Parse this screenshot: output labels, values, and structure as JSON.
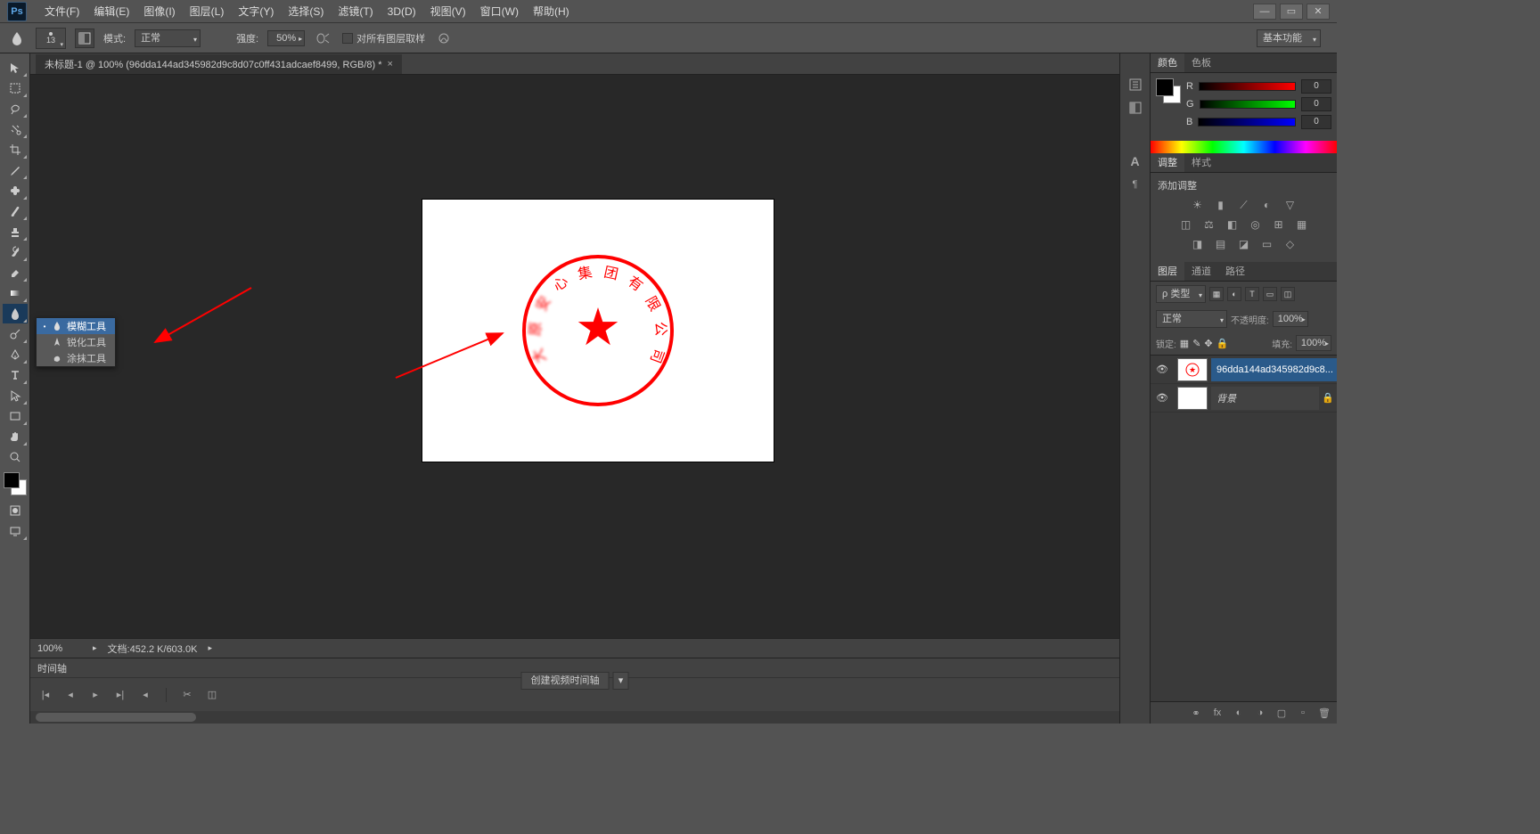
{
  "menu": {
    "items": [
      "文件(F)",
      "编辑(E)",
      "图像(I)",
      "图层(L)",
      "文字(Y)",
      "选择(S)",
      "滤镜(T)",
      "3D(D)",
      "视图(V)",
      "窗口(W)",
      "帮助(H)"
    ]
  },
  "optbar": {
    "brush_size": "13",
    "mode_lbl": "模式:",
    "mode_val": "正常",
    "strength_lbl": "强度:",
    "strength_val": "50%",
    "sample_all": "对所有图层取样",
    "basic": "基本功能"
  },
  "doc": {
    "tab": "未标题-1 @ 100% (96dda144ad345982d9c8d07c0ff431adcaef8499, RGB/8) *",
    "zoom": "100%",
    "info": "文档:452.2 K/603.0K"
  },
  "flyout": {
    "items": [
      "模糊工具",
      "锐化工具",
      "涂抹工具"
    ]
  },
  "timeline": {
    "title": "时间轴",
    "create": "创建视频时间轴"
  },
  "color": {
    "tab1": "颜色",
    "tab2": "色板",
    "r": "R",
    "g": "G",
    "b": "B",
    "rv": "0",
    "gv": "0",
    "bv": "0"
  },
  "adjust": {
    "tab1": "调整",
    "tab2": "样式",
    "title": "添加调整"
  },
  "layers": {
    "tab1": "图层",
    "tab2": "通道",
    "tab3": "路径",
    "filter": "ρ 类型",
    "blend": "正常",
    "opacity_lbl": "不透明度:",
    "opacity_val": "100%",
    "lock_lbl": "锁定:",
    "fill_lbl": "填充:",
    "fill_val": "100%",
    "l1_name": "96dda144ad345982d9c8...",
    "l2_name": "背景"
  },
  "seal_text": [
    "大",
    "原",
    "安",
    "心",
    "集",
    "团",
    "有",
    "限",
    "公",
    "司"
  ]
}
